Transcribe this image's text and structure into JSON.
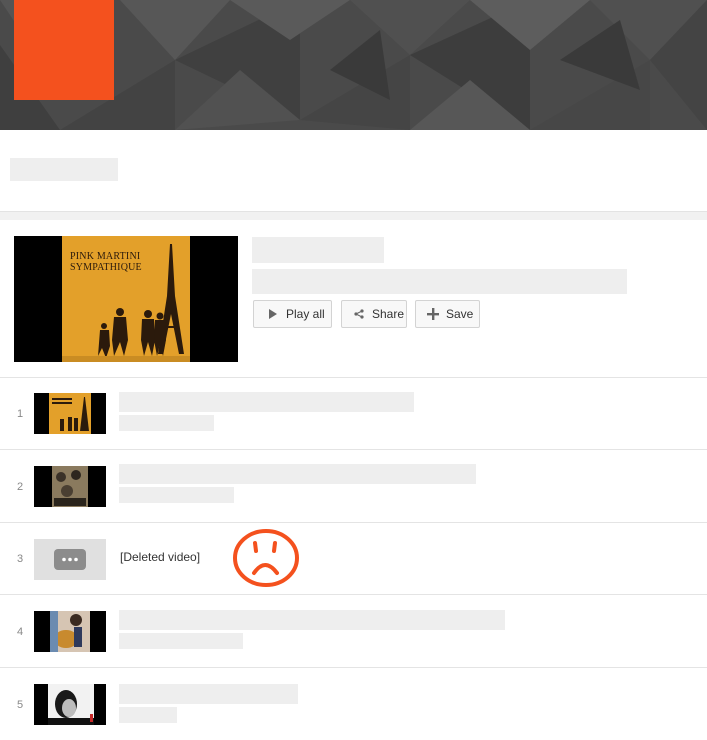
{
  "header_buttons": {
    "play_all": "Play all",
    "share": "Share",
    "save": "Save"
  },
  "album": {
    "line1": "PINK MARTINI",
    "line2": "SYMPATHIQUE"
  },
  "rows": [
    {
      "index": "1"
    },
    {
      "index": "2"
    },
    {
      "index": "3",
      "label": "[Deleted video]"
    },
    {
      "index": "4"
    },
    {
      "index": "5"
    }
  ],
  "colors": {
    "avatar": "#f4511e",
    "annotation": "#f4511e",
    "album_bg": "#e3a02a"
  }
}
